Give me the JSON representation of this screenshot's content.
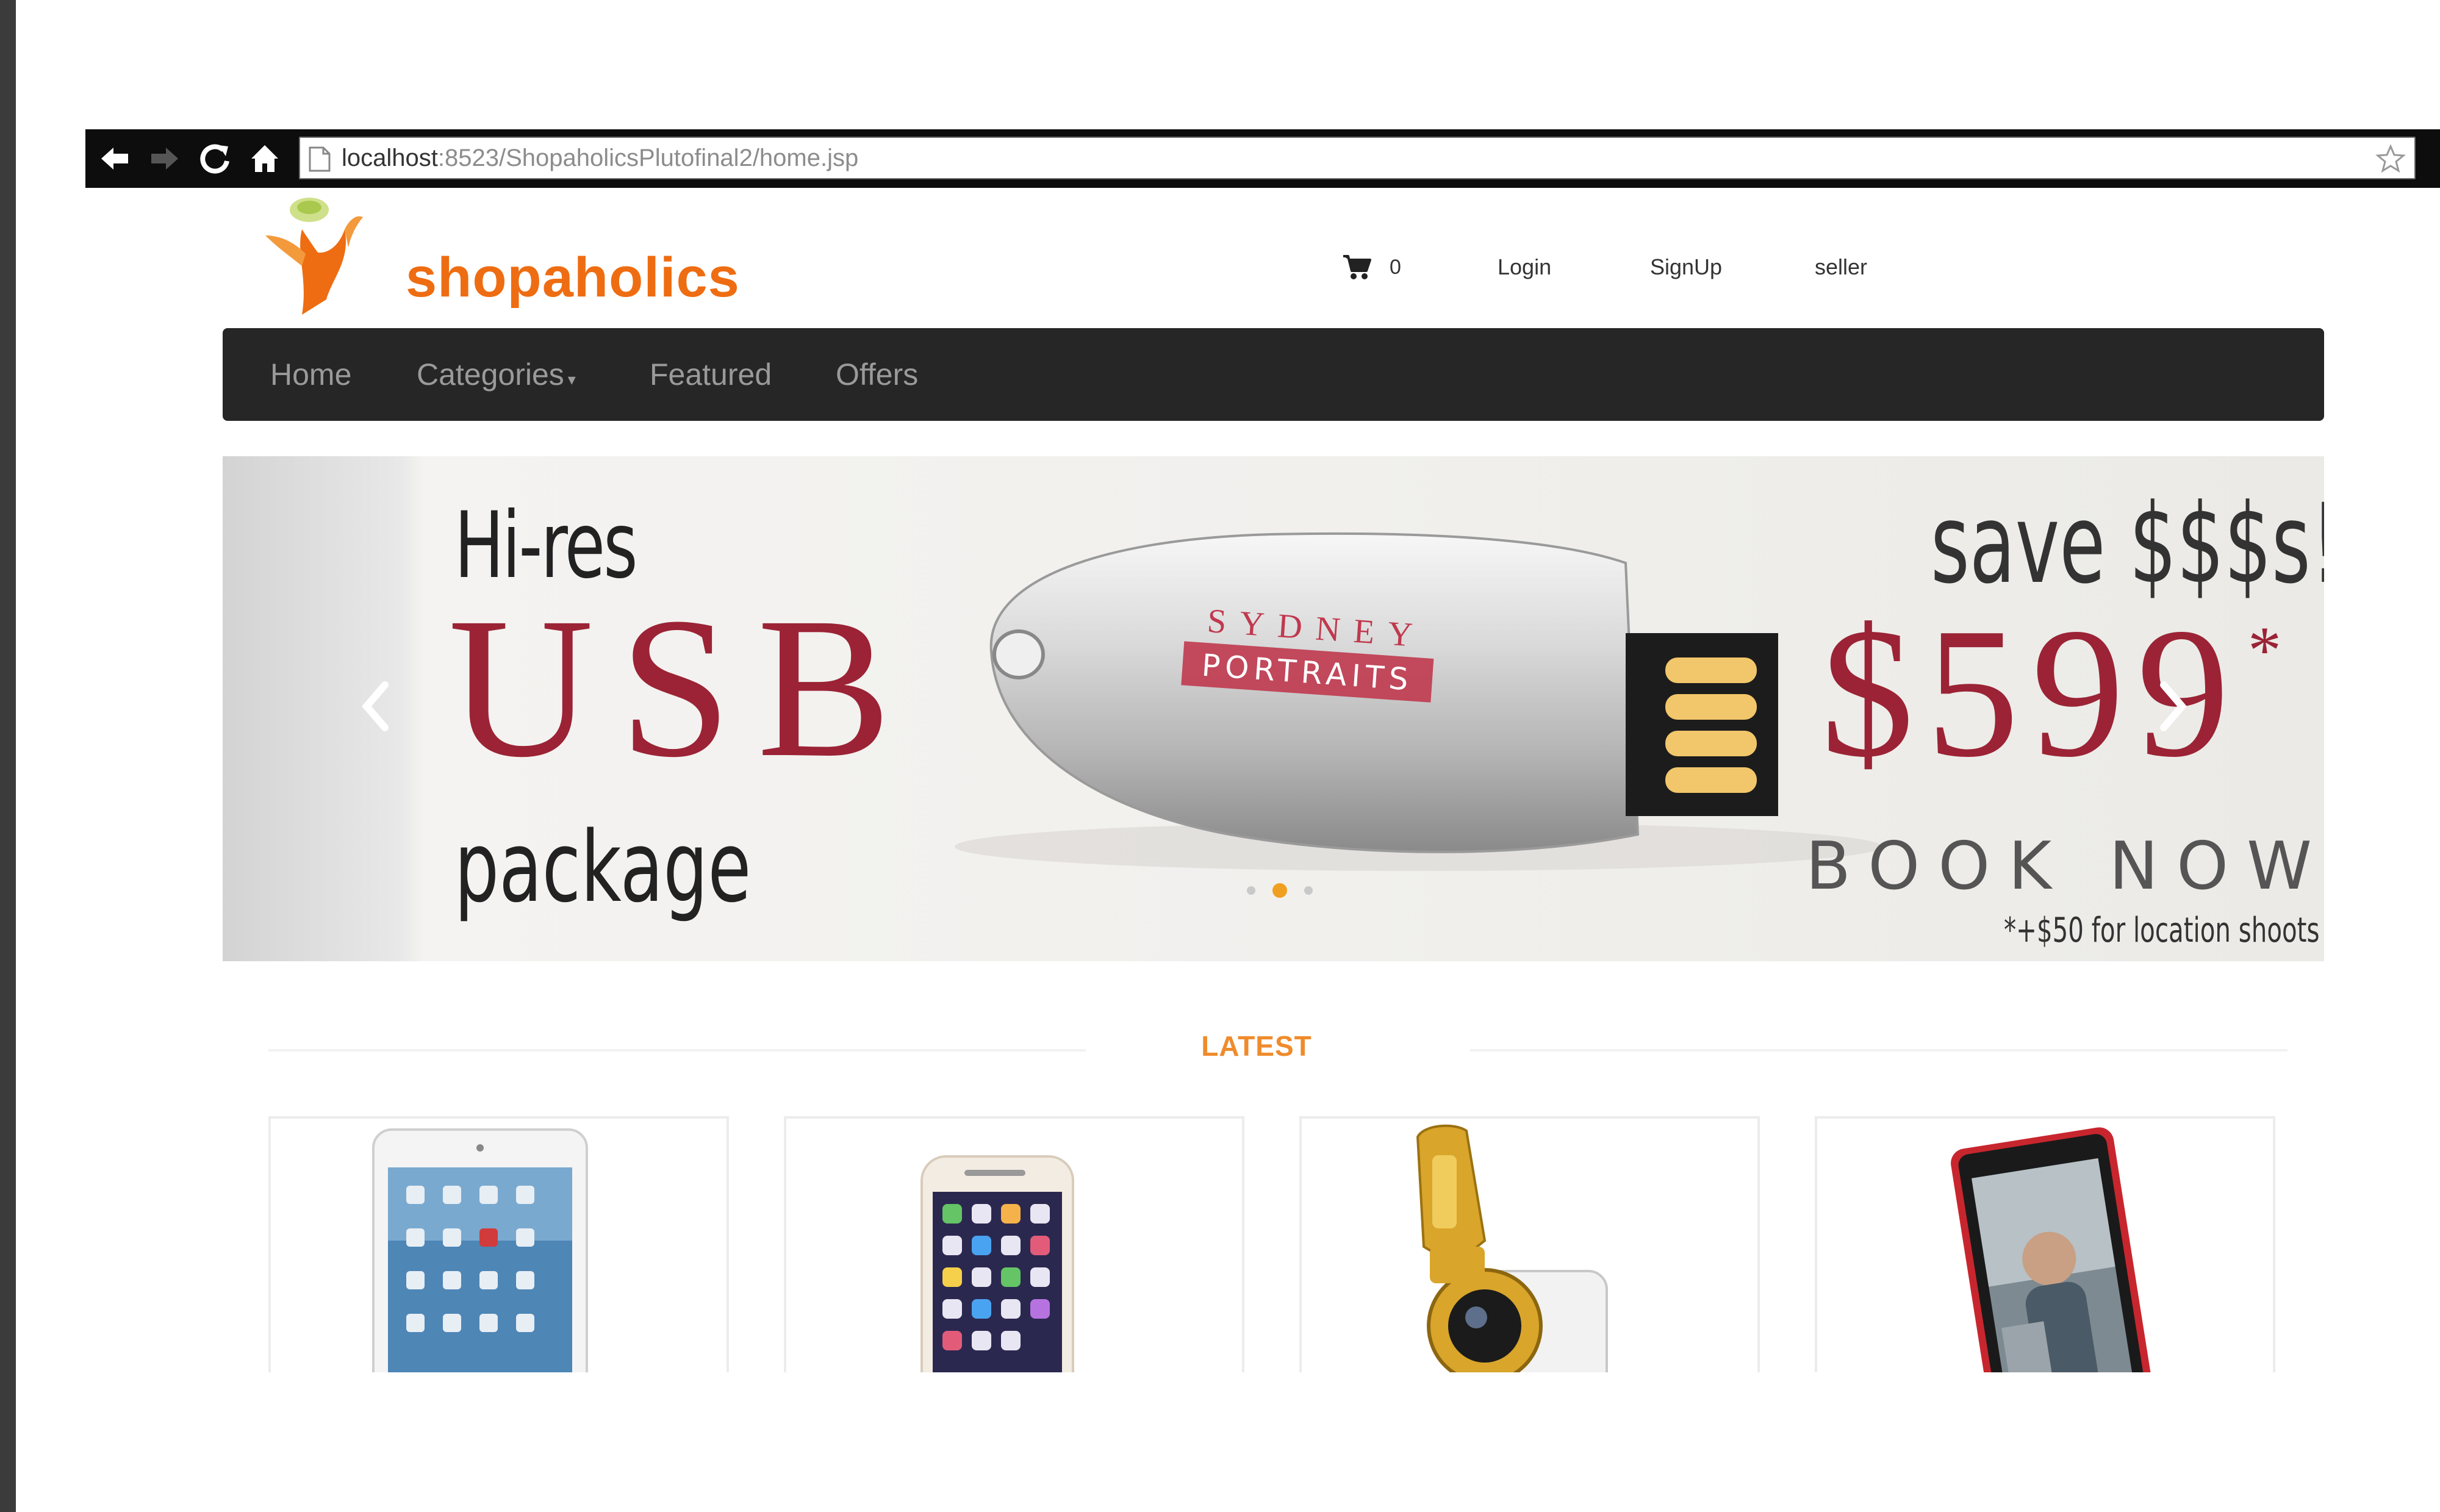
{
  "browser": {
    "url_host": "localhost",
    "url_path": ":8523/ShopaholicsPlutofinal2/home.jsp",
    "icons": [
      "back-arrow-icon",
      "forward-arrow-icon",
      "reload-icon",
      "home-icon",
      "page-icon",
      "bookmark-star-icon"
    ]
  },
  "brand": {
    "name": "shopaholics",
    "color": "#ee6d12"
  },
  "header": {
    "cart_count": "0",
    "links": {
      "login": "Login",
      "signup": "SignUp",
      "seller": "seller"
    }
  },
  "nav": {
    "home": "Home",
    "categories": "Categories",
    "featured": "Featured",
    "offers": "Offers"
  },
  "carousel": {
    "line1": "Hi-res",
    "line2": "USB",
    "line3": "package",
    "save": "save $$$s!",
    "price": "$599",
    "asterisk": "*",
    "cta": "BOOK NOW",
    "footnote": "*+$50 for location shoots",
    "usb_text_top": "SYDNEY",
    "usb_text_badge": "PORTRAITS",
    "slide_count": 3,
    "active_slide": 2,
    "accent_color": "#9b2335"
  },
  "latest": {
    "title": "LATEST",
    "products": [
      {
        "name": "tablet"
      },
      {
        "name": "smartphone"
      },
      {
        "name": "clip-lens"
      },
      {
        "name": "tablet-red"
      }
    ],
    "title_color": "#ef8b2c"
  }
}
